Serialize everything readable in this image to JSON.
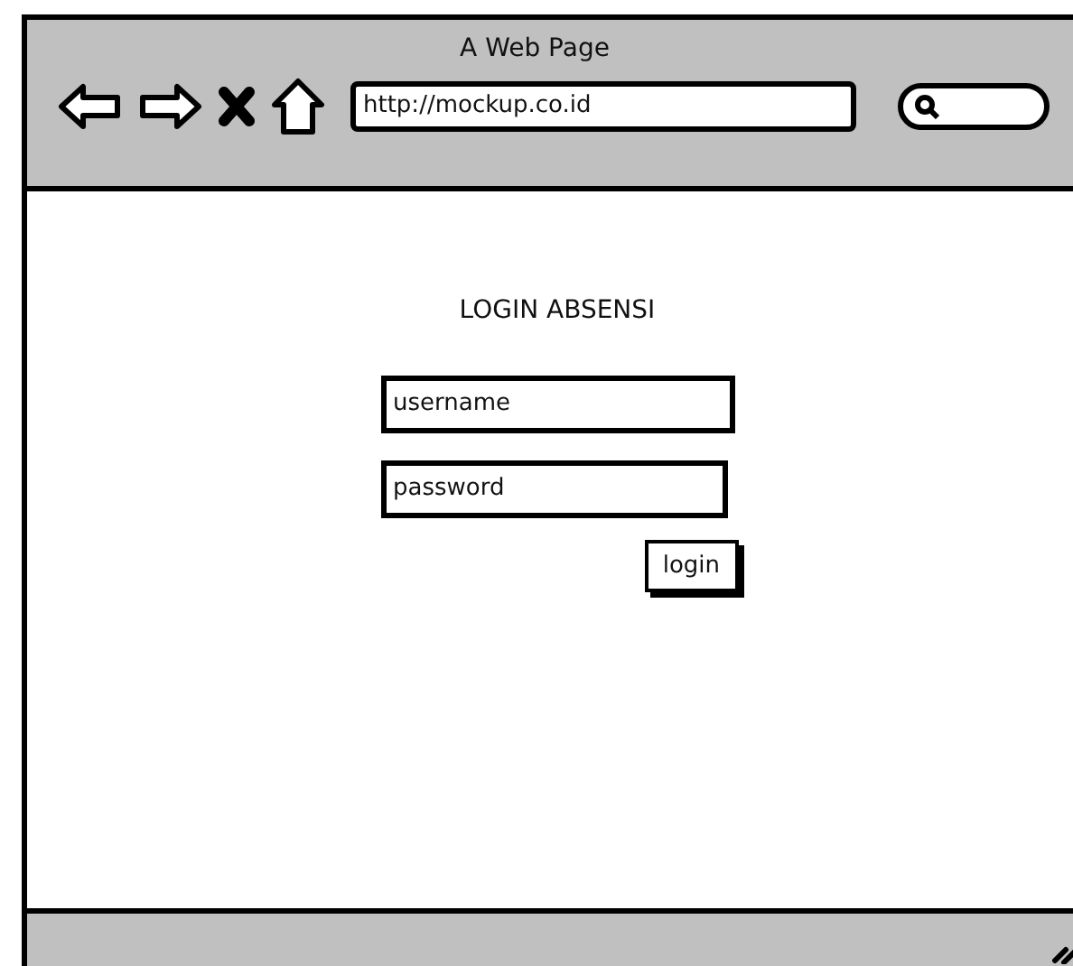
{
  "window": {
    "title": "A Web Page"
  },
  "toolbar": {
    "address": "http://mockup.co.id"
  },
  "login": {
    "heading": "LOGIN ABSENSI",
    "fields": [
      {
        "kind": "text",
        "value": "username"
      },
      {
        "kind": "password",
        "value": "password"
      }
    ],
    "button": "login"
  }
}
